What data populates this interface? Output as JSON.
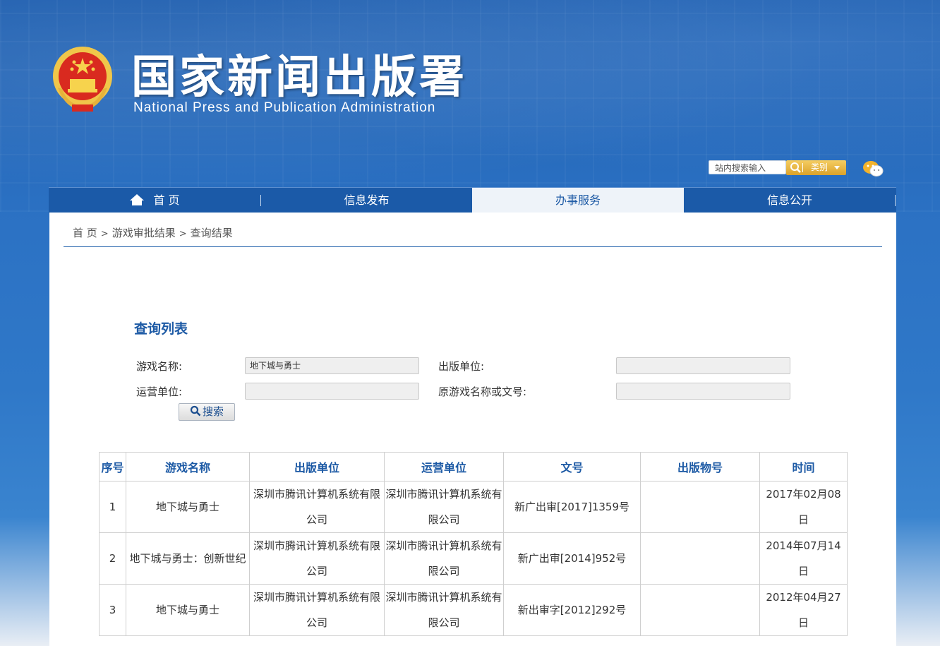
{
  "header": {
    "title_cn": "国家新闻出版署",
    "title_en": "National  Press and Publication Administration",
    "search": {
      "placeholder": "站内搜索输入",
      "category_label": "类别"
    }
  },
  "nav": {
    "items": [
      {
        "label": "首 页",
        "icon": "home-icon"
      },
      {
        "label": "信息发布"
      },
      {
        "label": "办事服务",
        "active": true
      },
      {
        "label": "信息公开"
      }
    ]
  },
  "breadcrumb": {
    "items": [
      "首 页",
      "游戏审批结果",
      "查询结果"
    ],
    "separator": ">"
  },
  "query": {
    "title": "查询列表",
    "fields": {
      "game_name": {
        "label": "游戏名称:",
        "value": "地下城与勇士"
      },
      "publisher": {
        "label": "出版单位:",
        "value": ""
      },
      "operator": {
        "label": "运营单位:",
        "value": ""
      },
      "original_name": {
        "label": "原游戏名称或文号:",
        "value": ""
      }
    },
    "search_button": "搜索"
  },
  "table": {
    "headers": [
      "序号",
      "游戏名称",
      "出版单位",
      "运营单位",
      "文号",
      "出版物号",
      "时间"
    ],
    "rows": [
      [
        "1",
        "地下城与勇士",
        "深圳市腾讯计算机系统有限公司",
        "深圳市腾讯计算机系统有限公司",
        "新广出审[2017]1359号",
        "",
        "2017年02月08日"
      ],
      [
        "2",
        "地下城与勇士：创新世纪",
        "深圳市腾讯计算机系统有限公司",
        "深圳市腾讯计算机系统有限公司",
        "新广出审[2014]952号",
        "",
        "2014年07月14日"
      ],
      [
        "3",
        "地下城与勇士",
        "深圳市腾讯计算机系统有限公司",
        "深圳市腾讯计算机系统有限公司",
        "新出审字[2012]292号",
        "",
        "2012年04月27日"
      ]
    ]
  },
  "colors": {
    "brand_blue": "#1d5aa5",
    "nav_bg": "#1b5aa8",
    "search_gold": "#e0a93a"
  }
}
